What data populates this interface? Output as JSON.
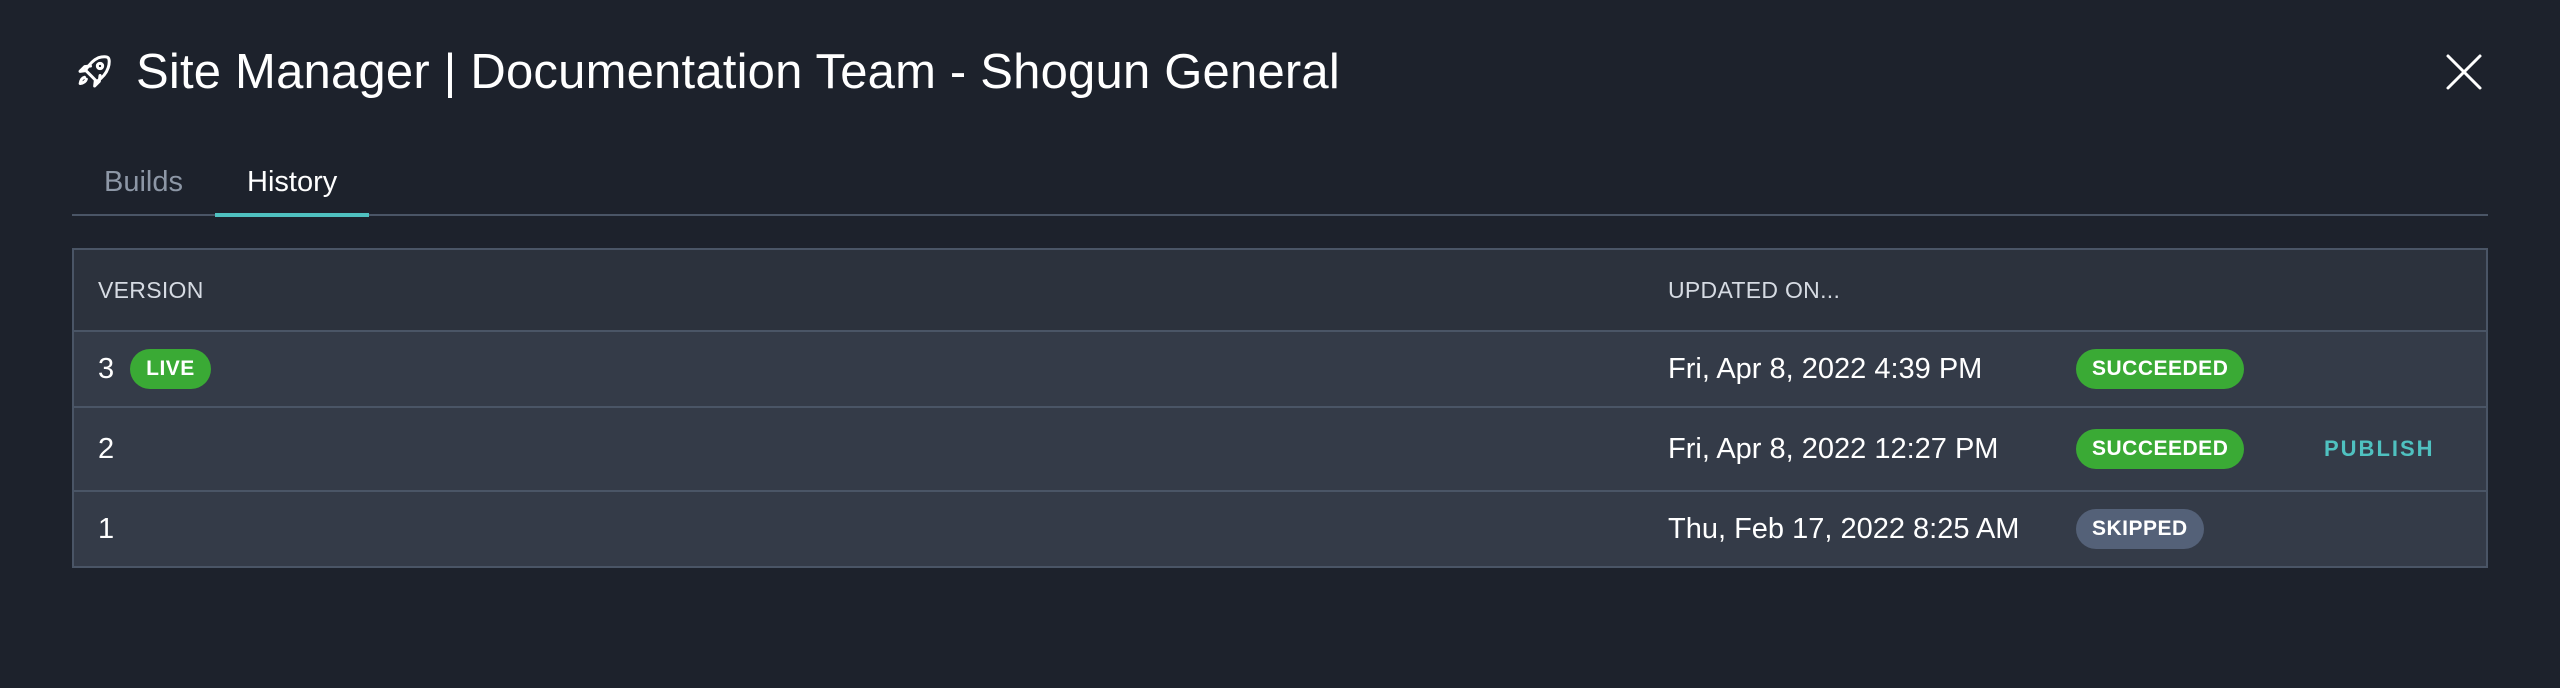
{
  "dialog": {
    "title": "Site Manager | Documentation Team - Shogun General",
    "icon": "rocket-icon",
    "close_icon": "close-icon"
  },
  "tabs": [
    {
      "label": "Builds",
      "active": false
    },
    {
      "label": "History",
      "active": true
    }
  ],
  "table": {
    "headers": {
      "version": "VERSION",
      "updated_on": "UPDATED ON..."
    },
    "rows": [
      {
        "version": "3",
        "live_badge": "LIVE",
        "updated_on": "Fri, Apr 8, 2022 4:39 PM",
        "status": "SUCCEEDED",
        "action": ""
      },
      {
        "version": "2",
        "live_badge": "",
        "updated_on": "Fri, Apr 8, 2022 12:27 PM",
        "status": "SUCCEEDED",
        "action": "PUBLISH"
      },
      {
        "version": "1",
        "live_badge": "",
        "updated_on": "Thu, Feb 17, 2022 8:25 AM",
        "status": "SKIPPED",
        "action": ""
      }
    ]
  },
  "colors": {
    "background": "#1d222c",
    "accent": "#4fc1c0",
    "success": "#3aaa35",
    "skipped": "#546178"
  }
}
